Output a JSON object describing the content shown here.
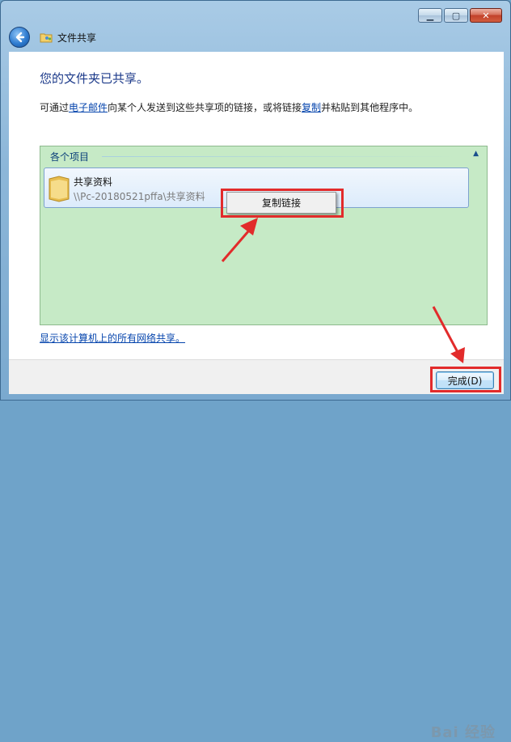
{
  "window": {
    "caption_buttons": {
      "minimize": "▁",
      "maximize": "▢",
      "close": "✕"
    }
  },
  "navbar": {
    "title": "文件共享",
    "back_icon": "back-arrow-icon",
    "app_icon": "file-sharing-icon"
  },
  "main": {
    "heading": "您的文件夹已共享。",
    "desc_prefix": "可通过",
    "desc_link1": "电子邮件",
    "desc_middle": "向某个人发送到这些共享项的链接，或将链接",
    "desc_link2": "复制",
    "desc_suffix": "并粘贴到其他程序中。"
  },
  "items_panel": {
    "title": "各个项目",
    "collapse_icon": "chevron-up-icon",
    "item": {
      "name": "共享资料",
      "path": "\\\\Pc-20180521pffa\\共享资料",
      "icon": "folder-icon"
    }
  },
  "context_menu": {
    "copy_link_label": "复制链接"
  },
  "footer": {
    "show_all_link": "显示该计算机上的所有网络共享。"
  },
  "buttons": {
    "finish_label": "完成(D)"
  },
  "watermark": {
    "text": "Bai 经验"
  },
  "colors": {
    "highlight_red": "#e22b2b",
    "panel_green": "#c6eac6",
    "heading_blue": "#1c3a8a"
  }
}
